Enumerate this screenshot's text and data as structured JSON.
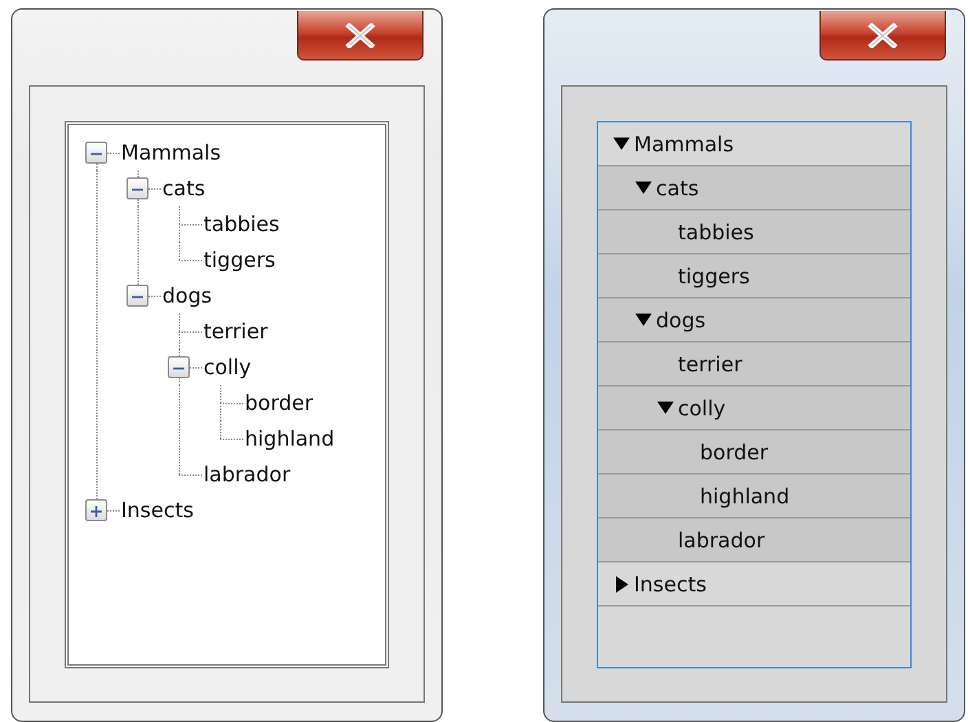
{
  "windows": [
    {
      "kind": "classic",
      "tree": [
        {
          "label": "Mammals",
          "expanded": true,
          "children": [
            {
              "label": "cats",
              "expanded": true,
              "children": [
                {
                  "label": "tabbies"
                },
                {
                  "label": "tiggers"
                }
              ]
            },
            {
              "label": "dogs",
              "expanded": true,
              "children": [
                {
                  "label": "terrier"
                },
                {
                  "label": "colly",
                  "expanded": true,
                  "children": [
                    {
                      "label": "border"
                    },
                    {
                      "label": "highland"
                    }
                  ]
                },
                {
                  "label": "labrador"
                }
              ]
            }
          ]
        },
        {
          "label": "Insects",
          "expanded": false
        }
      ]
    },
    {
      "kind": "flat",
      "tree": [
        {
          "label": "Mammals",
          "expanded": true,
          "children": [
            {
              "label": "cats",
              "expanded": true,
              "children": [
                {
                  "label": "tabbies"
                },
                {
                  "label": "tiggers"
                }
              ]
            },
            {
              "label": "dogs",
              "expanded": true,
              "children": [
                {
                  "label": "terrier"
                },
                {
                  "label": "colly",
                  "expanded": true,
                  "children": [
                    {
                      "label": "border"
                    },
                    {
                      "label": "highland"
                    }
                  ]
                },
                {
                  "label": "labrador"
                }
              ]
            }
          ]
        },
        {
          "label": "Insects",
          "expanded": false
        }
      ]
    }
  ]
}
